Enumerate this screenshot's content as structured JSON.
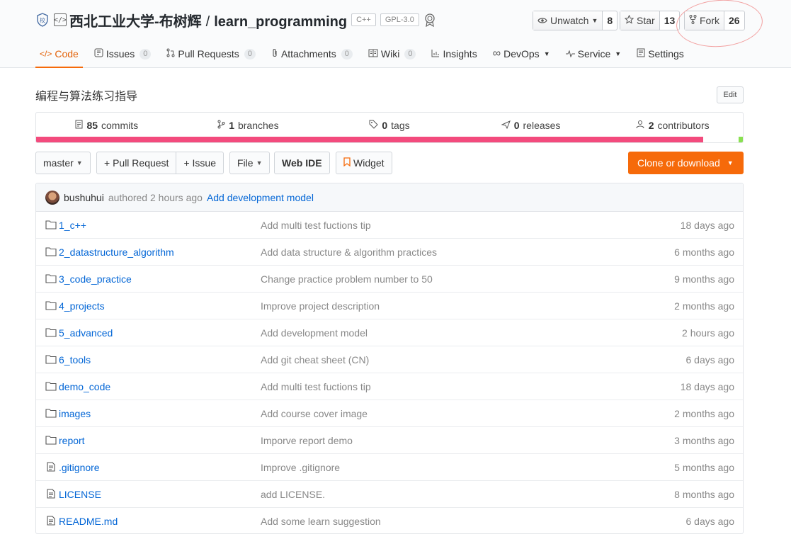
{
  "repo": {
    "owner": "西北工业大学-布树辉",
    "separator": "/",
    "name": "learn_programming",
    "tags": [
      "C++",
      "GPL-3.0"
    ],
    "description": "编程与算法练习指导",
    "edit_label": "Edit"
  },
  "social": {
    "watch_label": "Unwatch",
    "watch_count": "8",
    "star_label": "Star",
    "star_count": "13",
    "fork_label": "Fork",
    "fork_count": "26"
  },
  "nav": {
    "code": "Code",
    "issues": "Issues",
    "issues_count": "0",
    "pulls": "Pull Requests",
    "pulls_count": "0",
    "attachments": "Attachments",
    "attachments_count": "0",
    "wiki": "Wiki",
    "wiki_count": "0",
    "insights": "Insights",
    "devops": "DevOps",
    "service": "Service",
    "settings": "Settings"
  },
  "stats": {
    "commits_num": "85",
    "commits_label": "commits",
    "branches_num": "1",
    "branches_label": "branches",
    "tags_num": "0",
    "tags_label": "tags",
    "releases_num": "0",
    "releases_label": "releases",
    "contributors_num": "2",
    "contributors_label": "contributors",
    "language_fractions": [
      0.944,
      0.05,
      0.006
    ],
    "language_colors": [
      "#f34b7d",
      "#ffffff",
      "#89e051"
    ]
  },
  "toolbar": {
    "branch": "master",
    "pull_request": "+ Pull Request",
    "issue": "+ Issue",
    "file": "File",
    "web_ide": "Web IDE",
    "widget": "Widget",
    "clone": "Clone or download"
  },
  "last_commit": {
    "author": "bushuhui",
    "verb_time": "authored 2 hours ago",
    "message": "Add development model"
  },
  "files": [
    {
      "name": "1_c++",
      "type": "dir",
      "message": "Add multi test fuctions tip",
      "age": "18 days ago"
    },
    {
      "name": "2_datastructure_algorithm",
      "type": "dir",
      "message": "Add data structure & algorithm practices",
      "age": "6 months ago"
    },
    {
      "name": "3_code_practice",
      "type": "dir",
      "message": "Change practice problem number to 50",
      "age": "9 months ago"
    },
    {
      "name": "4_projects",
      "type": "dir",
      "message": "Improve project description",
      "age": "2 months ago"
    },
    {
      "name": "5_advanced",
      "type": "dir",
      "message": "Add development model",
      "age": "2 hours ago"
    },
    {
      "name": "6_tools",
      "type": "dir",
      "message": "Add git cheat sheet (CN)",
      "age": "6 days ago"
    },
    {
      "name": "demo_code",
      "type": "dir",
      "message": "Add multi test fuctions tip",
      "age": "18 days ago"
    },
    {
      "name": "images",
      "type": "dir",
      "message": "Add course cover image",
      "age": "2 months ago"
    },
    {
      "name": "report",
      "type": "dir",
      "message": "Imporve report demo",
      "age": "3 months ago"
    },
    {
      "name": ".gitignore",
      "type": "file",
      "message": "Improve .gitignore",
      "age": "5 months ago"
    },
    {
      "name": "LICENSE",
      "type": "file",
      "message": "add LICENSE.",
      "age": "8 months ago"
    },
    {
      "name": "README.md",
      "type": "file",
      "message": "Add some learn suggestion",
      "age": "6 days ago"
    }
  ]
}
